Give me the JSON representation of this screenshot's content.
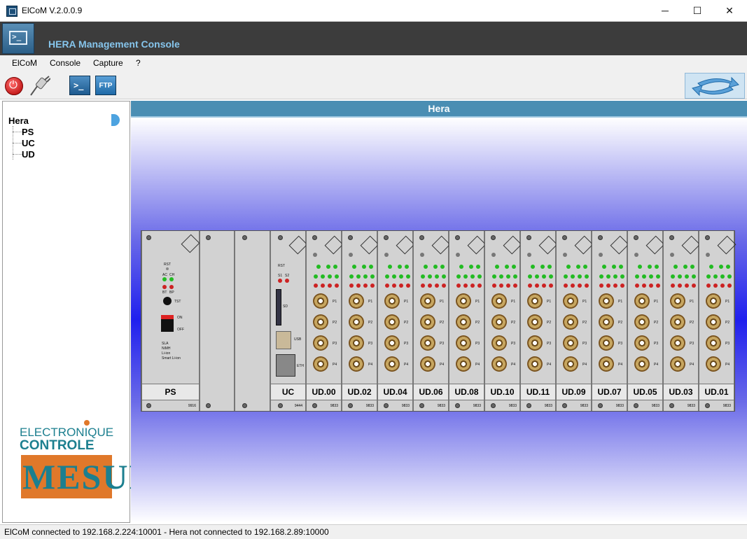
{
  "window": {
    "title": "ElCoM V.2.0.0.9",
    "minimize": "─",
    "maximize": "☐",
    "close": "✕"
  },
  "header": {
    "title": "HERA Management Console"
  },
  "menu": [
    "ElCoM",
    "Console",
    "Capture",
    "?"
  ],
  "toolbar": {
    "power_icon": "power-icon",
    "connect_icon": "plug-icon",
    "console_label": ">_",
    "ftp_label": "FTP",
    "refresh_icon": "refresh-icon"
  },
  "tree": {
    "root": "Hera",
    "children": [
      "PS",
      "UC",
      "UD"
    ]
  },
  "logo": {
    "line1": "ELECTRONIQUE",
    "line2": "CONTROLE",
    "line3": "MESURE"
  },
  "main": {
    "title": "Hera"
  },
  "rack": {
    "ps": {
      "label": "PS",
      "number": "9916",
      "rst": "RST",
      "ac": "AC",
      "ch": "CH",
      "bt": "BT",
      "bp": "BP",
      "tst": "TST",
      "on": "ON",
      "off": "OFF",
      "legend": [
        "SLA",
        "NiMH",
        "Li-ion",
        "Smart Li-ion"
      ]
    },
    "uc": {
      "label": "UC",
      "number": "9444",
      "rst": "RST",
      "s1": "S1",
      "s2": "S2",
      "sd": "SD",
      "usb": "USB",
      "eth": "ETH"
    },
    "ud_cards": [
      "UD.00",
      "UD.02",
      "UD.04",
      "UD.06",
      "UD.08",
      "UD.10",
      "UD.11",
      "UD.09",
      "UD.07",
      "UD.05",
      "UD.03",
      "UD.01"
    ],
    "ud_number": "9833",
    "ud_ports": [
      "P1",
      "P2",
      "P3",
      "P4"
    ]
  },
  "status": {
    "text": "ElCoM connected to 192.168.2.224:10001  -  Hera not connected to 192.168.2.89:10000"
  },
  "colors": {
    "header_bar": "#4a8eb3",
    "title_text": "#86c5ec",
    "led_green": "#22bb22",
    "led_red": "#cc2222"
  }
}
